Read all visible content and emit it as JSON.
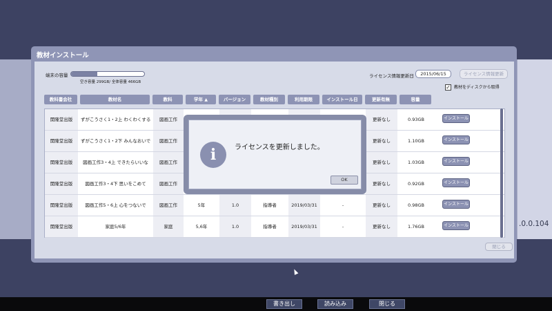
{
  "window": {
    "title": "教材インストール",
    "storage": {
      "label": "端末の容量",
      "fill_fraction": 0.36,
      "text": "空き容量 299GB/ 全体容量 466GB"
    },
    "license": {
      "label": "ライセンス情報更新日",
      "date": "2015/06/15",
      "update_button": "ライセンス情報更新"
    },
    "checkbox": {
      "checked": true,
      "label": "教材をディスクから取得"
    },
    "columns": [
      "教科書会社",
      "教材名",
      "教科",
      "学年",
      "バージョン",
      "教材種別",
      "利用期限",
      "インストール日",
      "更新有無",
      "容量"
    ],
    "rows": [
      {
        "company": "開隆堂出版",
        "name": "ずがこうさく1・2上 わくわくするね",
        "subject": "図画工作",
        "grade": "",
        "version": "",
        "type": "",
        "expiry": "",
        "install_date": "",
        "update": "更新なし",
        "size": "0.93GB",
        "action": "インストール"
      },
      {
        "company": "開隆堂出版",
        "name": "ずがこうさく1・2下 みんなおいでよ",
        "subject": "図画工作",
        "grade": "",
        "version": "",
        "type": "",
        "expiry": "",
        "install_date": "",
        "update": "更新なし",
        "size": "1.10GB",
        "action": "インストール"
      },
      {
        "company": "開隆堂出版",
        "name": "図画工作3・4上 できたらいいな",
        "subject": "図画工作",
        "grade": "",
        "version": "",
        "type": "",
        "expiry": "",
        "install_date": "",
        "update": "更新なし",
        "size": "1.03GB",
        "action": "インストール"
      },
      {
        "company": "開隆堂出版",
        "name": "図画工作3・4下 思いをこめて",
        "subject": "図画工作",
        "grade": "",
        "version": "",
        "type": "",
        "expiry": "",
        "install_date": "",
        "update": "更新なし",
        "size": "0.92GB",
        "action": "インストール"
      },
      {
        "company": "開隆堂出版",
        "name": "図画工作5・6上 心をつないで",
        "subject": "図画工作",
        "grade": "5年",
        "version": "1.0",
        "type": "指導者",
        "expiry": "2019/03/31",
        "install_date": "-",
        "update": "更新なし",
        "size": "0.98GB",
        "action": "インストール"
      },
      {
        "company": "開隆堂出版",
        "name": "家庭5/6年",
        "subject": "家庭",
        "grade": "5,6年",
        "version": "1.0",
        "type": "指導者",
        "expiry": "2019/03/31",
        "install_date": "-",
        "update": "更新なし",
        "size": "1.76GB",
        "action": "インストール"
      }
    ],
    "close_button": "閉じる"
  },
  "dialog": {
    "icon": "info-icon",
    "message": "ライセンスを更新しました。",
    "ok_button": "OK"
  },
  "background": {
    "version_text": ".0.0.104"
  },
  "taskbar": {
    "buttons": [
      "書き出し",
      "読み込み",
      "閉じる"
    ]
  },
  "colors": {
    "background": "#3d4262",
    "window_frame": "#8f95b6",
    "header_cell": "#8d93b4",
    "install_button": "#8c92b3"
  }
}
